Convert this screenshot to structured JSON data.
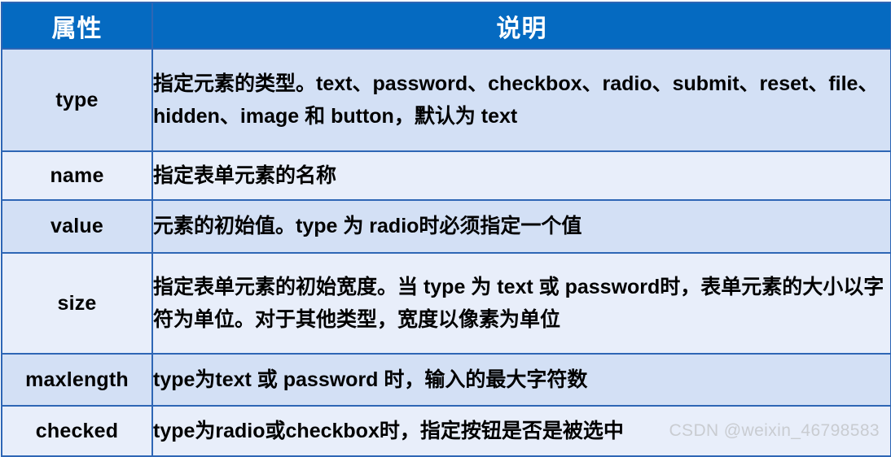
{
  "table": {
    "headers": {
      "attribute": "属性",
      "description": "说明"
    },
    "rows": [
      {
        "attribute": "type",
        "description": "指定元素的类型。text、password、checkbox、radio、submit、reset、file、hidden、image 和 button，默认为 text"
      },
      {
        "attribute": "name",
        "description": "指定表单元素的名称"
      },
      {
        "attribute": "value",
        "description": "元素的初始值。type 为 radio时必须指定一个值"
      },
      {
        "attribute": "size",
        "description": "指定表单元素的初始宽度。当 type 为 text 或 password时，表单元素的大小以字符为单位。对于其他类型，宽度以像素为单位"
      },
      {
        "attribute": "maxlength",
        "description": "type为text 或 password 时，输入的最大字符数"
      },
      {
        "attribute": "checked",
        "description": "type为radio或checkbox时，指定按钮是否是被选中"
      }
    ]
  },
  "watermark": {
    "text": "CSDN @weixin_46798583"
  },
  "colors": {
    "header_bg": "#056ac1",
    "header_text": "#ffffff",
    "border": "#2e66b5",
    "row_dark": "#d3e0f5",
    "row_light": "#e8eefa",
    "body_text": "#000000",
    "watermark": "#c9ccd1"
  }
}
